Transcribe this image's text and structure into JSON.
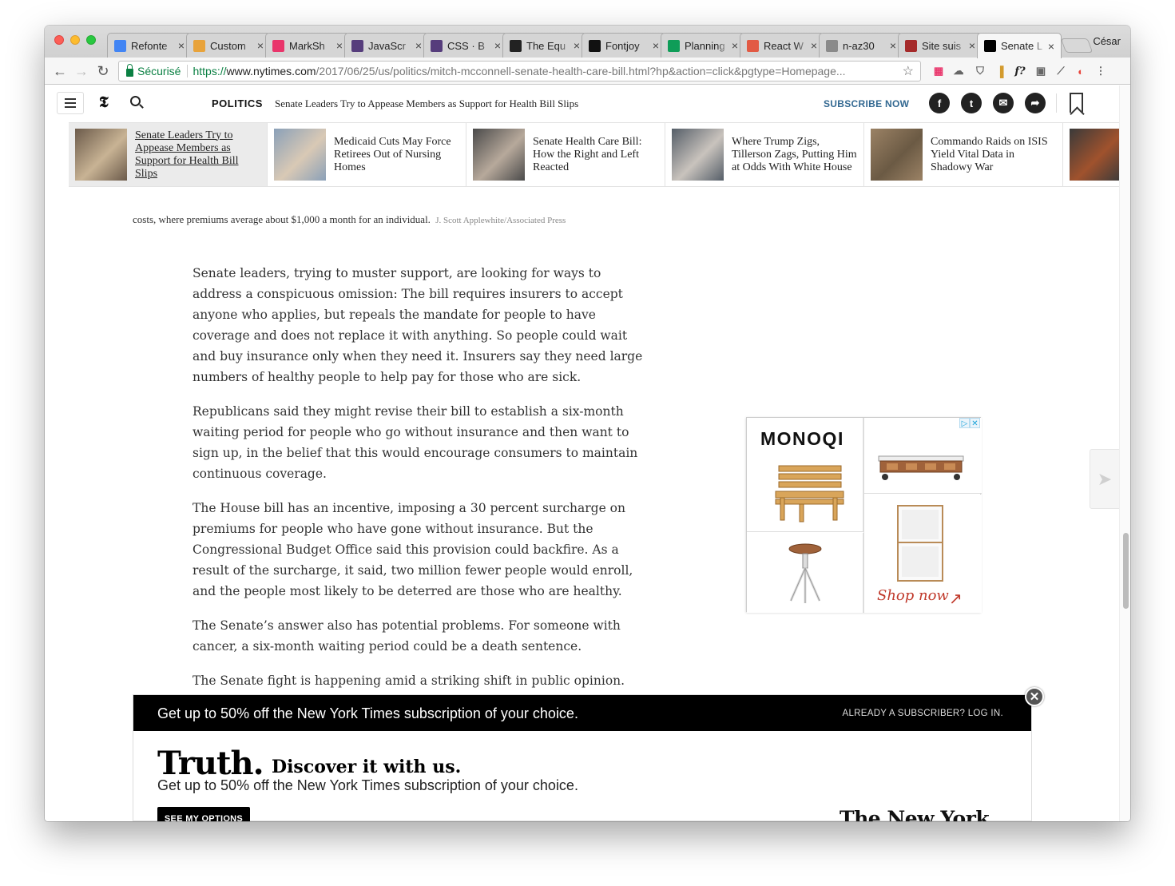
{
  "browser": {
    "tabs": [
      {
        "label": "Refonte",
        "favicon": "docs-icon",
        "color": "#4285f4"
      },
      {
        "label": "Custom",
        "favicon": "chrome-icon",
        "color": "#e8a33b"
      },
      {
        "label": "MarkSh",
        "favicon": "markshare-icon",
        "color": "#e9356b"
      },
      {
        "label": "JavaScr",
        "favicon": "bootstrap-icon",
        "color": "#563d7c"
      },
      {
        "label": "CSS · B",
        "favicon": "bootstrap-icon",
        "color": "#563d7c"
      },
      {
        "label": "The Equ",
        "favicon": "equation-icon",
        "color": "#222222"
      },
      {
        "label": "Fontjoy",
        "favicon": "fontjoy-icon",
        "color": "#111111"
      },
      {
        "label": "Planning",
        "favicon": "sheets-icon",
        "color": "#0f9d58"
      },
      {
        "label": "React W",
        "favicon": "react-icon",
        "color": "#e25a44"
      },
      {
        "label": "n-az30",
        "favicon": "t-icon",
        "color": "#8a8a8a"
      },
      {
        "label": "Site suis",
        "favicon": "t-icon",
        "color": "#a52a2a"
      },
      {
        "label": "Senate L",
        "favicon": "nyt-icon",
        "color": "#000000",
        "active": true
      }
    ],
    "tab_close_glyph": "×",
    "profile_name": "César",
    "omnibox": {
      "secure_label": "Sécurisé",
      "scheme": "https://",
      "host": "www.nytimes.com",
      "path": "/2017/06/25/us/politics/mitch-mcconnell-senate-health-care-bill.html?hp&action=click&pgtype=Homepage..."
    }
  },
  "header": {
    "section": "POLITICS",
    "headline": "Senate Leaders Try to Appease Members as Support for Health Bill Slips",
    "subscribe": "SUBSCRIBE NOW",
    "logo_glyph": "𝕿",
    "social": {
      "facebook": "f",
      "twitter": "t",
      "email": "✉",
      "share": "➦"
    }
  },
  "related": [
    {
      "title": "Senate Leaders Try to Appease Members as Support for Health Bill Slips",
      "selected": true,
      "thumb": [
        "#6b5a4a",
        "#c8b394"
      ]
    },
    {
      "title": "Medicaid Cuts May Force Retirees Out of Nursing Homes",
      "thumb": [
        "#8aa0b8",
        "#d9c9b5"
      ]
    },
    {
      "title": "Senate Health Care Bill: How the Right and Left Reacted",
      "thumb": [
        "#4a4a4a",
        "#b7a99b"
      ]
    },
    {
      "title": "Where Trump Zigs, Tillerson Zags, Putting Him at Odds With White House",
      "thumb": [
        "#555e68",
        "#c9c3bd"
      ]
    },
    {
      "title": "Commando Raids on ISIS Yield Vital Data in Shadowy War",
      "thumb": [
        "#9b8265",
        "#6b5a44"
      ]
    },
    {
      "title": "",
      "thumb": [
        "#3a3a3a",
        "#a0522d"
      ]
    }
  ],
  "caption": {
    "text": "costs, where premiums average about $1,000 a month for an individual.",
    "credit": "J. Scott Applewhite/Associated Press"
  },
  "article": {
    "paragraphs": [
      "Senate leaders, trying to muster support, are looking for ways to address a conspicuous omission: The bill requires insurers to accept anyone who applies, but repeals the mandate for people to have coverage and does not replace it with anything. So people could wait and buy insurance only when they need it. Insurers say they need large numbers of healthy people to help pay for those who are sick.",
      "Republicans said they might revise their bill to establish a six-month waiting period for people who go without insurance and then want to sign up, in the belief that this would encourage consumers to maintain continuous coverage.",
      "The House bill has an incentive, imposing a 30 percent surcharge on premiums for people who have gone without insurance. But the Congressional Budget Office said this provision could backfire. As a result of the surcharge, it said, two million fewer people would enroll, and the people most likely to be deterred are those who are healthy.",
      "The Senate’s answer also has potential problems. For someone with cancer, a six-month waiting period could be a death sentence.",
      "The Senate fight is happening amid a striking shift in public opinion. Fifty-"
    ]
  },
  "ad": {
    "brand": "MONOQI",
    "cta": "Shop now",
    "choices": [
      "▷",
      "✕"
    ]
  },
  "subscription": {
    "top_text": "Get up to 50% off the New York Times subscription of your choice.",
    "login": "ALREADY A SUBSCRIBER? LOG IN.",
    "headline_big": "Truth.",
    "headline_small": "Discover it with us.",
    "body": "Get up to 50% off the New York Times subscription of your choice.",
    "button": "SEE MY OPTIONS",
    "logo": "The New York Times",
    "close_glyph": "✕"
  }
}
